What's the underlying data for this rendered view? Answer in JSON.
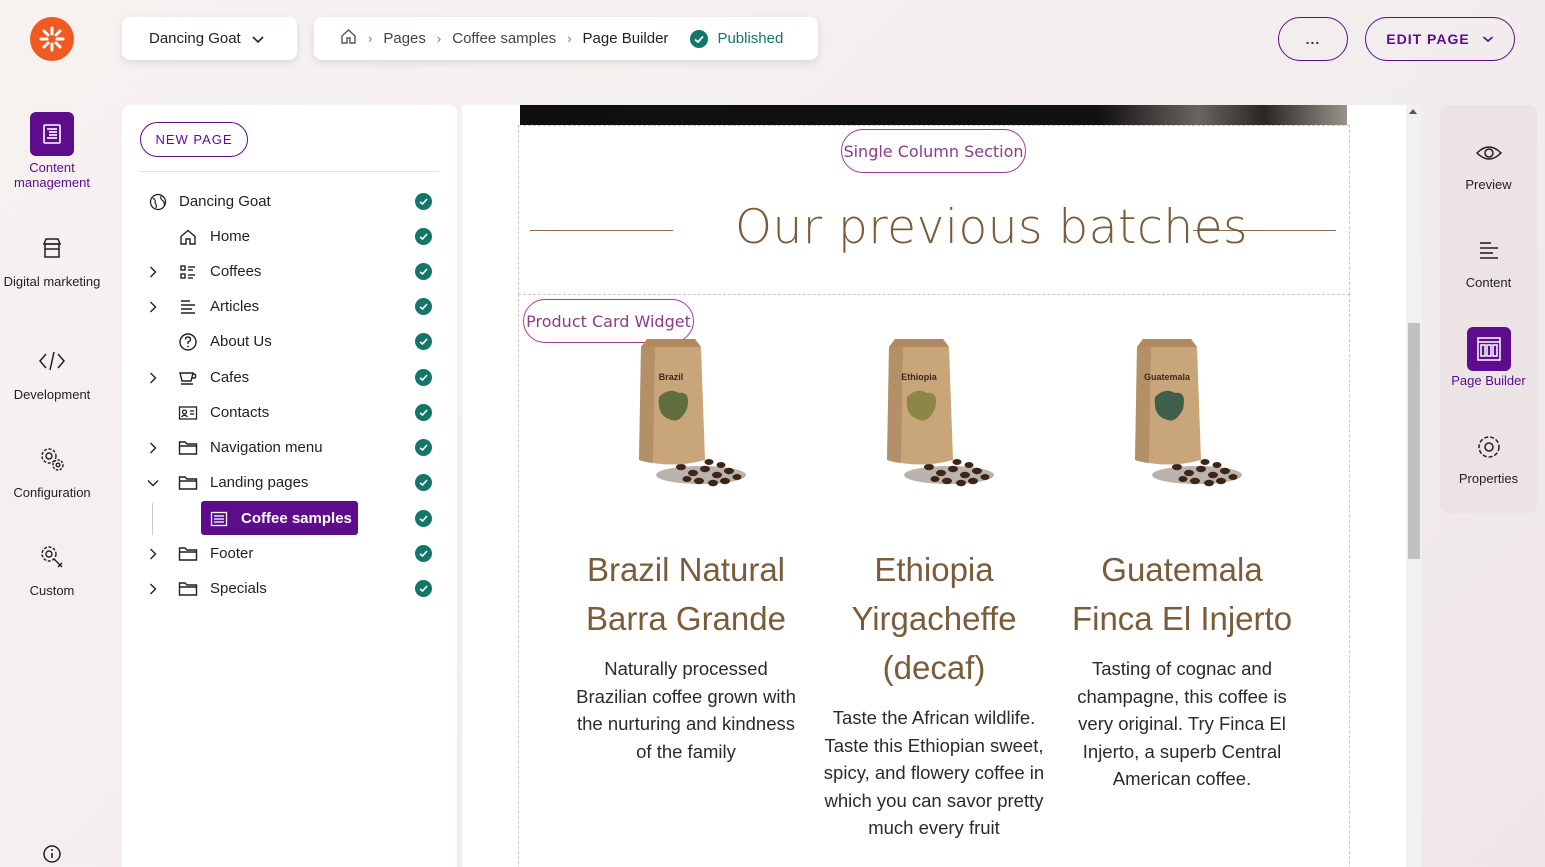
{
  "left_nav": {
    "items": [
      {
        "label": "Content management",
        "icon": "content-management-icon",
        "active": true
      },
      {
        "label": "Digital marketing",
        "icon": "digital-marketing-icon",
        "active": false
      },
      {
        "label": "Development",
        "icon": "development-icon",
        "active": false
      },
      {
        "label": "Configuration",
        "icon": "configuration-icon",
        "active": false
      },
      {
        "label": "Custom",
        "icon": "custom-icon",
        "active": false
      }
    ]
  },
  "header": {
    "channel": "Dancing Goat",
    "breadcrumb": {
      "items": [
        "Pages",
        "Coffee samples"
      ],
      "current": "Page Builder",
      "status": "Published"
    },
    "more_label": "...",
    "edit_page_label": "EDIT PAGE"
  },
  "tree": {
    "new_page_label": "NEW PAGE",
    "items": [
      {
        "label": "Dancing Goat",
        "icon": "globe-icon",
        "expandable": false
      },
      {
        "label": "Home",
        "icon": "home-icon",
        "expandable": false
      },
      {
        "label": "Coffees",
        "icon": "list-icon",
        "expandable": true
      },
      {
        "label": "Articles",
        "icon": "article-icon",
        "expandable": true
      },
      {
        "label": "About Us",
        "icon": "question-icon",
        "expandable": false
      },
      {
        "label": "Cafes",
        "icon": "cup-icon",
        "expandable": true
      },
      {
        "label": "Contacts",
        "icon": "contact-card-icon",
        "expandable": false
      },
      {
        "label": "Navigation menu",
        "icon": "folder-icon",
        "expandable": true
      },
      {
        "label": "Landing pages",
        "icon": "folder-icon",
        "expandable": true,
        "expanded": true
      },
      {
        "label": "Coffee samples",
        "icon": "page-icon",
        "selected": true
      },
      {
        "label": "Footer",
        "icon": "folder-icon",
        "expandable": true
      },
      {
        "label": "Specials",
        "icon": "folder-icon",
        "expandable": true
      }
    ]
  },
  "canvas": {
    "section_tag": "Single Column Section",
    "section_title": "Our previous batches",
    "widget_tag": "Product Card Widget",
    "products": [
      {
        "bag_label": "Brazil",
        "name": "Brazil Natural Barra Grande",
        "description": "Naturally processed Brazilian coffee grown with the nurturing and kindness of the family"
      },
      {
        "bag_label": "Ethiopia",
        "name": "Ethiopia Yirgacheffe (decaf)",
        "description": "Taste the African wildlife. Taste this Ethiopian sweet, spicy, and flowery coffee in which you can savor pretty much every fruit"
      },
      {
        "bag_label": "Guatemala",
        "name": "Guatemala Finca El Injerto",
        "description": "Tasting of cognac and champagne, this coffee is very original. Try Finca El Injerto, a superb Central American coffee."
      }
    ]
  },
  "right_panel": {
    "items": [
      {
        "label": "Preview",
        "icon": "eye-icon",
        "active": false
      },
      {
        "label": "Content",
        "icon": "content-icon",
        "active": false
      },
      {
        "label": "Page Builder",
        "icon": "page-builder-icon",
        "active": true
      },
      {
        "label": "Properties",
        "icon": "properties-gear-icon",
        "active": false
      }
    ]
  },
  "colors": {
    "accent": "#5d0c8b",
    "published": "#14756b",
    "logo": "#f05a22",
    "coffee_brown": "#7a5c3a"
  }
}
